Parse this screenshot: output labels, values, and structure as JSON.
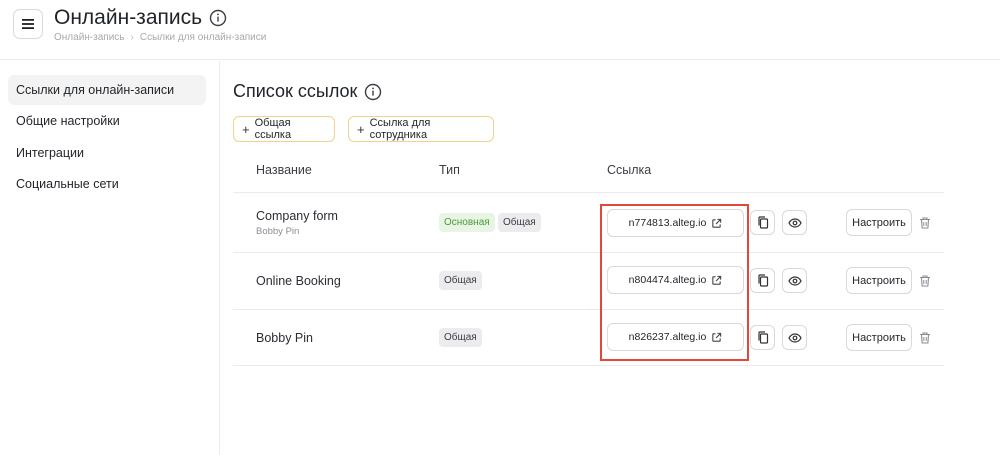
{
  "header": {
    "title": "Онлайн-запись",
    "breadcrumb": [
      "Онлайн-запись",
      "Ссылки для онлайн-записи"
    ],
    "icons": {
      "menu": "hamburger-menu-icon",
      "info": "info-icon"
    }
  },
  "sidebar": {
    "items": [
      {
        "label": "Ссылки для онлайн-записи",
        "active": true
      },
      {
        "label": "Общие настройки",
        "active": false
      },
      {
        "label": "Интеграции",
        "active": false
      },
      {
        "label": "Социальные сети",
        "active": false
      }
    ]
  },
  "main": {
    "title": "Список ссылок",
    "buttons": {
      "add_common": "Общая ссылка",
      "add_employee": "Ссылка для сотрудника"
    },
    "table": {
      "columns": [
        "Название",
        "Тип",
        "Ссылка"
      ],
      "rows": [
        {
          "name": "Company form",
          "subtitle": "Bobby Pin",
          "types": [
            "Основная",
            "Общая"
          ],
          "link": "n774813.alteg.io",
          "configure": "Настроить"
        },
        {
          "name": "Online Booking",
          "subtitle": "",
          "types": [
            "Общая"
          ],
          "link": "n804474.alteg.io",
          "configure": "Настроить"
        },
        {
          "name": "Bobby Pin",
          "subtitle": "",
          "types": [
            "Общая"
          ],
          "link": "n826237.alteg.io",
          "configure": "Настроить"
        }
      ]
    }
  },
  "colors": {
    "accent_border": "#f0d48a",
    "badge_main_bg": "#e8f5e4",
    "badge_main_text": "#4a9a3a",
    "highlight": "#e0483c"
  }
}
